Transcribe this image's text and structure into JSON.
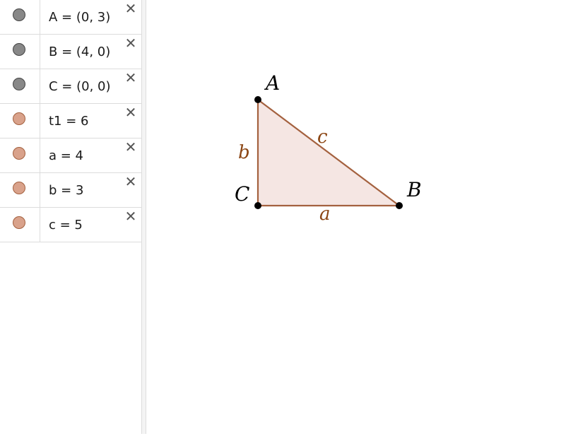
{
  "algebra": {
    "items": [
      {
        "text": "A = (0, 3)",
        "color": "#888888",
        "stroke": "#444444",
        "delete": "✕"
      },
      {
        "text": "B = (4, 0)",
        "color": "#888888",
        "stroke": "#444444",
        "delete": "✕"
      },
      {
        "text": "C = (0, 0)",
        "color": "#888888",
        "stroke": "#444444",
        "delete": "✕"
      },
      {
        "text": "t1 = 6",
        "color": "#d9a28b",
        "stroke": "#a4613f",
        "delete": "✕"
      },
      {
        "text": "a = 4",
        "color": "#d9a28b",
        "stroke": "#a4613f",
        "delete": "✕"
      },
      {
        "text": "b = 3",
        "color": "#d9a28b",
        "stroke": "#a4613f",
        "delete": "✕"
      },
      {
        "text": "c = 5",
        "color": "#d9a28b",
        "stroke": "#a4613f",
        "delete": "✕"
      }
    ]
  },
  "graphics": {
    "points": [
      {
        "name": "A",
        "x": 0,
        "y": 3
      },
      {
        "name": "B",
        "x": 4,
        "y": 0
      },
      {
        "name": "C",
        "x": 0,
        "y": 0
      }
    ],
    "segments": [
      {
        "name": "a",
        "from": "C",
        "to": "B"
      },
      {
        "name": "b",
        "from": "C",
        "to": "A"
      },
      {
        "name": "c",
        "from": "A",
        "to": "B"
      }
    ],
    "polygon_fill": "#f5e6e3",
    "segment_color": "#a4613f",
    "point_color": "#000000",
    "label_color_points": "#000000",
    "label_color_segments": "#8b4513"
  }
}
